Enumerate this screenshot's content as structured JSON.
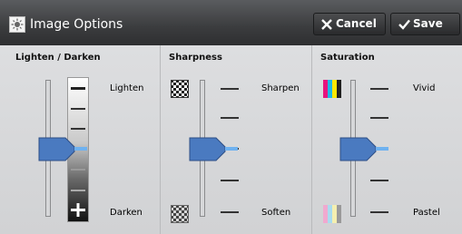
{
  "header": {
    "title": "Image Options",
    "title_icon": "image-options-icon",
    "cancel_label": "Cancel",
    "save_label": "Save"
  },
  "panels": {
    "lighten": {
      "title": "Lighten / Darken",
      "top_label": "Lighten",
      "bottom_label": "Darken",
      "level": 0.5
    },
    "sharpness": {
      "title": "Sharpness",
      "top_label": "Sharpen",
      "bottom_label": "Soften",
      "level": 0.5
    },
    "saturation": {
      "title": "Saturation",
      "top_label": "Vivid",
      "bottom_label": "Pastel",
      "level": 0.5
    }
  },
  "colors": {
    "header": "#3b3c3e",
    "panel": "#d8d9db",
    "handle": "#4a7ac0",
    "handle_tip": "#6fb2f0"
  }
}
